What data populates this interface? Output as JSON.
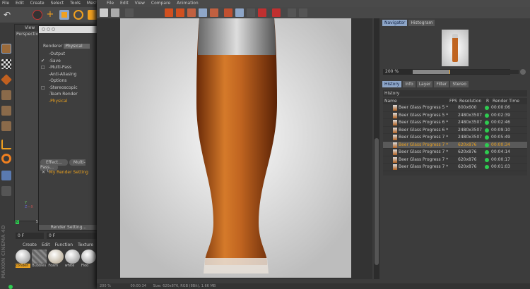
{
  "main_menu": [
    "File",
    "Edit",
    "Create",
    "Select",
    "Tools",
    "Mesh"
  ],
  "viewer_menu": [
    "File",
    "Edit",
    "View",
    "Compare",
    "Animation"
  ],
  "viewport": {
    "menu": "View",
    "label": "Perspective"
  },
  "render_settings": {
    "renderer_label": "Renderer",
    "renderer_value": "Physical",
    "items": [
      {
        "label": "Output",
        "check": ""
      },
      {
        "label": "Save",
        "check": "✔"
      },
      {
        "label": "Multi-Pass",
        "check": "□"
      },
      {
        "label": "Anti-Aliasing",
        "check": ""
      },
      {
        "label": "Options",
        "check": ""
      },
      {
        "label": "Stereoscopic",
        "check": "□"
      },
      {
        "label": "Team Render",
        "check": ""
      },
      {
        "label": "Physical",
        "check": ""
      }
    ],
    "effect_button": "Effect...",
    "multipass_button": "Multi-Pass...",
    "setting_name": "My Render Setting",
    "render_setting_button": "Render Setting..."
  },
  "timeline": {
    "start": "0",
    "end": "5",
    "frame": "0 F",
    "frame2": "0 F"
  },
  "material_manager": {
    "menu": [
      "Create",
      "Edit",
      "Function",
      "Texture"
    ],
    "materials": [
      "conden",
      "Bubbles",
      "Foam",
      "white",
      "Floo"
    ]
  },
  "brand": "MAXON CINEMA 4D",
  "navigator": {
    "tabs": [
      "Navigator",
      "Histogram"
    ],
    "zoom": "200 %",
    "zoom_fraction": 0.35
  },
  "history": {
    "tabs": [
      "History",
      "Info",
      "Layer",
      "Filter",
      "Stereo"
    ],
    "title": "History",
    "columns": [
      "Name",
      "FPS",
      "Resolution",
      "R",
      "Render Time"
    ],
    "rows": [
      {
        "name": "Beer Glass Progress 5 *",
        "res": "800x600",
        "time": "00:00:06"
      },
      {
        "name": "Beer Glass Progress 5 *",
        "res": "2480x3507",
        "time": "00:02:39"
      },
      {
        "name": "Beer Glass Progress 6 *",
        "res": "2480x3507",
        "time": "00:02:46"
      },
      {
        "name": "Beer Glass Progress 6 *",
        "res": "2480x3507",
        "time": "00:09:10"
      },
      {
        "name": "Beer Glass Progress 7 *",
        "res": "2480x3507",
        "time": "00:05:49"
      },
      {
        "name": "Beer Glass Progress 7 *",
        "res": "620x876",
        "time": "00:00:34",
        "selected": true
      },
      {
        "name": "Beer Glass Progress 7 *",
        "res": "620x876",
        "time": "00:04:14"
      },
      {
        "name": "Beer Glass Progress 7 *",
        "res": "620x876",
        "time": "00:00:17"
      },
      {
        "name": "Beer Glass Progress 7 *",
        "res": "620x876",
        "time": "00:01:03"
      }
    ]
  },
  "status": {
    "zoom": "200 %",
    "time": "00:00:34",
    "info": "Size: 620x876, RGB (8Bit), 1.66 MB"
  },
  "colors": {
    "accent": "#e8a020",
    "status_green": "#2ecc50",
    "tab_active": "#8ea6c8"
  }
}
